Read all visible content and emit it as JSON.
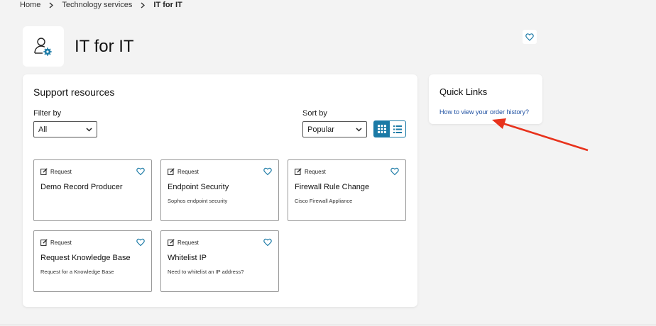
{
  "breadcrumb": {
    "items": [
      "Home",
      "Technology services"
    ],
    "current": "IT for IT"
  },
  "page": {
    "title": "IT for IT",
    "icon": "user-gear-icon",
    "favorite_icon": "heart-outline-icon"
  },
  "support": {
    "title": "Support resources",
    "filter_label": "Filter by",
    "filter_value": "All",
    "sort_label": "Sort by",
    "sort_value": "Popular",
    "view_modes": [
      "grid-view-icon",
      "list-view-icon"
    ],
    "active_view": "grid"
  },
  "cards": [
    {
      "tag": "Request",
      "title": "Demo Record Producer",
      "desc": ""
    },
    {
      "tag": "Request",
      "title": "Endpoint Security",
      "desc": "Sophos endpoint security"
    },
    {
      "tag": "Request",
      "title": "Firewall Rule Change",
      "desc": "Cisco Firewall Appliance"
    },
    {
      "tag": "Request",
      "title": "Request Knowledge Base",
      "desc": "Request for a Knowledge Base"
    },
    {
      "tag": "Request",
      "title": "Whitelist IP",
      "desc": "Need to whitelist an IP address?"
    }
  ],
  "quick_links": {
    "title": "Quick Links",
    "links": [
      "How to view your order history?"
    ]
  },
  "colors": {
    "accent": "#1b7aa6",
    "link": "#1e50a2",
    "annotation_arrow": "#e8321c"
  }
}
